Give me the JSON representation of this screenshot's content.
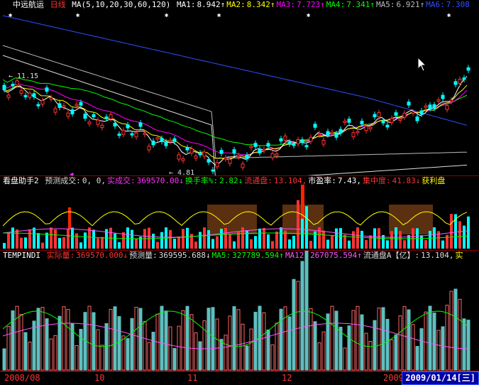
{
  "main": {
    "stock_name": "中远航运",
    "period": "日线",
    "ma_spec": "MA(5,10,20,30,60,120)",
    "ma_items": [
      {
        "label": "MA1:",
        "value": "8.942↑",
        "color": "#ffffff"
      },
      {
        "label": "MA2:",
        "value": "8.342↑",
        "color": "#ffff00"
      },
      {
        "label": "MA3:",
        "value": "7.723↑",
        "color": "#ff00ff"
      },
      {
        "label": "MA4:",
        "value": "7.341↑",
        "color": "#00ff00"
      },
      {
        "label": "MA5:",
        "value": "6.921↑",
        "color": "#bbbbbb"
      },
      {
        "label": "MA6:",
        "value": "7.308",
        "color": "#2f4fff"
      }
    ],
    "high_label": "11.15",
    "low_label": "4.81"
  },
  "ind1": {
    "name": "看盘助手2",
    "items": [
      {
        "label": "预测成交:",
        "value": "0, 0,",
        "color": "#dddddd"
      },
      {
        "label": "实成交:",
        "value": "369570.00↓",
        "color": "#ff33ff"
      },
      {
        "label": "换手率%:",
        "value": "2.82↓",
        "color": "#00ff00"
      },
      {
        "label": "流通盘:",
        "value": "13.104,",
        "color": "#ff3333"
      },
      {
        "label": "市盈率:",
        "value": "7.43,",
        "color": "#ffffff"
      },
      {
        "label": "集中度:",
        "value": "41.83↓",
        "color": "#ff3333"
      },
      {
        "label": "获利盘",
        "value": "",
        "color": "#ffff00"
      }
    ]
  },
  "ind2": {
    "name": "TEMPINDI",
    "items": [
      {
        "label": "实际量:",
        "value": "369570.000↓",
        "color": "#ff3333"
      },
      {
        "label": "预测量:",
        "value": "369595.688↓",
        "color": "#dddddd"
      },
      {
        "label": "MA5:",
        "value": "327789.594↑",
        "color": "#00ff00"
      },
      {
        "label": "MA12:",
        "value": "267075.594↑",
        "color": "#ff55ff"
      },
      {
        "label": "流通盘A【亿】:",
        "value": "13.104,",
        "color": "#dddddd"
      },
      {
        "label": "实",
        "value": "",
        "color": "#ffff00"
      }
    ]
  },
  "axis": {
    "ticks": [
      "2008/08",
      "10",
      "11",
      "12",
      "2009"
    ],
    "date_readout": "2009/01/14[三]"
  }
}
